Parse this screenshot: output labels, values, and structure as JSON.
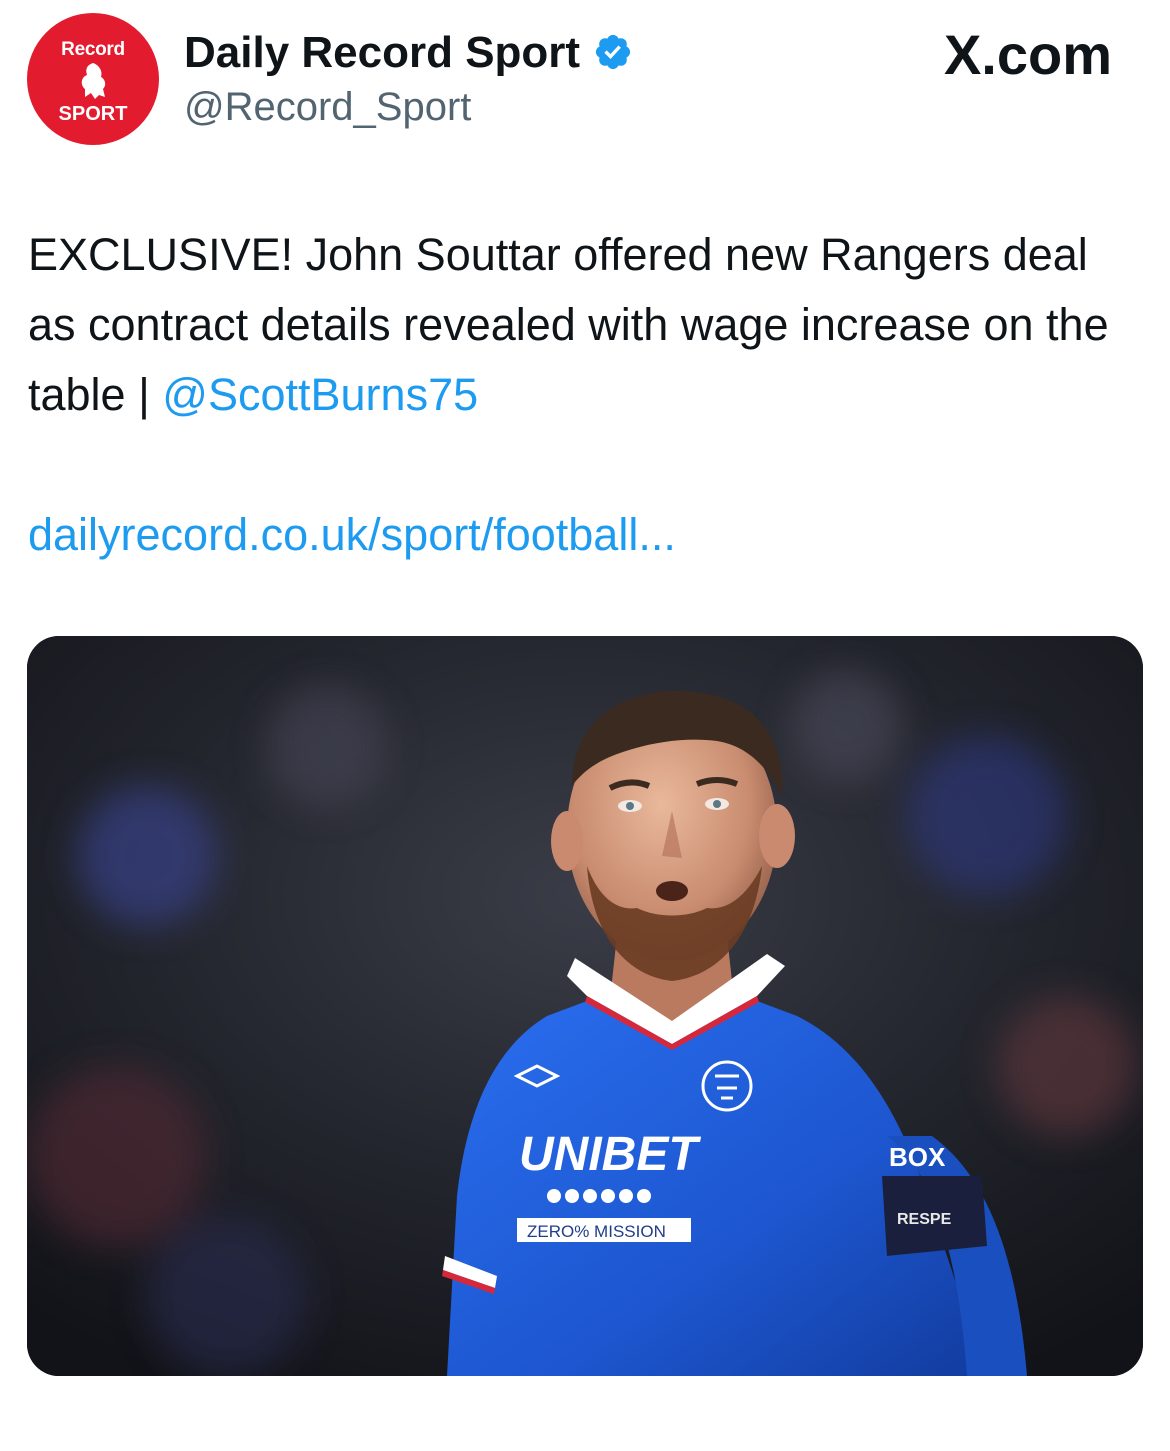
{
  "account": {
    "avatar_top": "Record",
    "avatar_bottom": "SPORT",
    "display_name": "Daily Record Sport",
    "handle": "@Record_Sport",
    "verified_icon": "verified-badge-icon",
    "brand": "X.com"
  },
  "tweet": {
    "text": "EXCLUSIVE! John Souttar offered new Rangers deal as contract details revealed with wage increase on the table | ",
    "mention": "@ScottBurns75",
    "link": "dailyrecord.co.uk/sport/football..."
  },
  "media": {
    "sponsor": "UNIBET",
    "sponsor_sub": "ZERO% MISSION",
    "sleeve_text": "BOX",
    "armband_text": "RESPE"
  },
  "colors": {
    "link_blue": "#1d9bf0",
    "avatar_red": "#e31b2f",
    "jersey_blue": "#1f5bd6",
    "text_primary": "#0f1419",
    "text_secondary": "#536471"
  }
}
